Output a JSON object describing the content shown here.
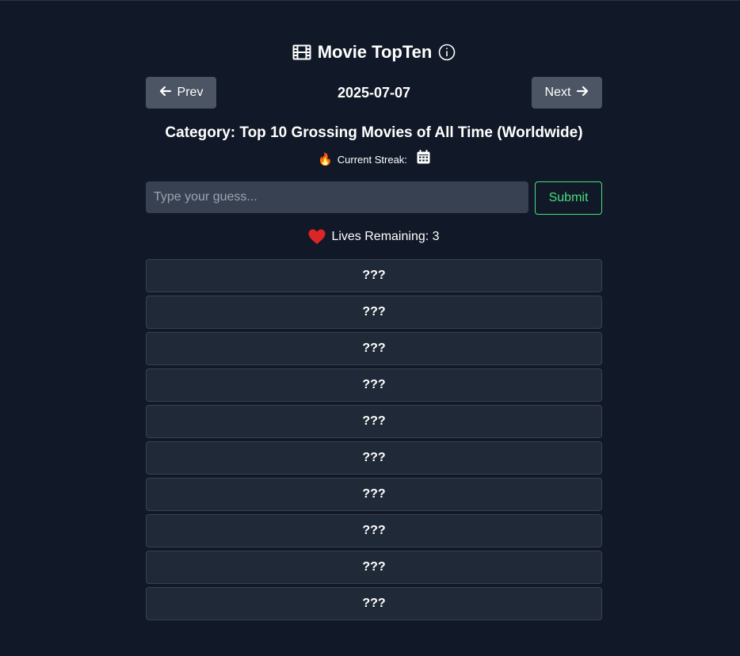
{
  "header": {
    "title": "Movie TopTen",
    "film_icon": "film-icon",
    "info_icon": "info-icon"
  },
  "nav": {
    "prev_label": "Prev",
    "next_label": "Next",
    "date": "2025-07-07"
  },
  "category": "Category: Top 10 Grossing Movies of All Time (Worldwide)",
  "streak": {
    "fire_emoji": "🔥",
    "label": "Current Streak:",
    "calendar_icon": "calendar-icon"
  },
  "guess": {
    "placeholder": "Type your guess...",
    "value": "",
    "submit_label": "Submit"
  },
  "lives": {
    "label": "Lives Remaining: 3",
    "heart_icon": "heart-icon"
  },
  "answers": [
    "???",
    "???",
    "???",
    "???",
    "???",
    "???",
    "???",
    "???",
    "???",
    "???"
  ],
  "colors": {
    "background": "#111827",
    "nav_button": "#4b5563",
    "input_bg": "#374151",
    "submit_accent": "#4ade80",
    "slot_bg": "#1f2937",
    "heart": "#dc2626"
  }
}
